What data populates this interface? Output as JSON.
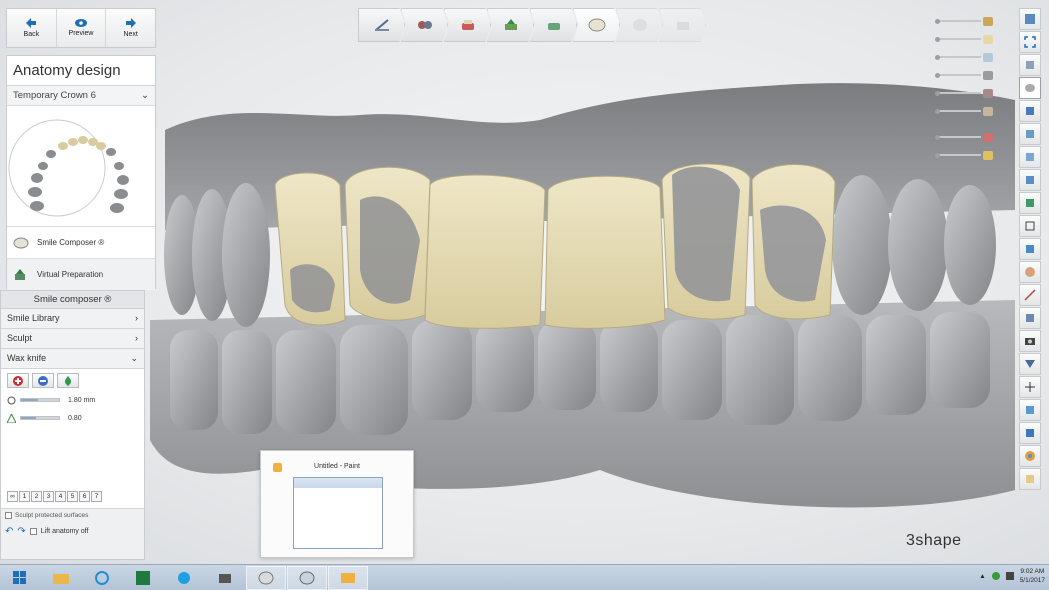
{
  "nav": {
    "back_label": "Back",
    "preview_label": "Preview",
    "next_label": "Next"
  },
  "workflow": {
    "steps": [
      "scan-step-icon",
      "preparation-step-icon",
      "crown-step-icon",
      "model-step-icon",
      "gingiva-step-icon",
      "anatomy-step-icon",
      "tooth-step-icon",
      "export-step-icon"
    ],
    "active_index": 5
  },
  "panel": {
    "title": "Anatomy design",
    "restoration": "Temporary Crown 6",
    "smile_composer_label": "Smile Composer ®",
    "virtual_preparation_label": "Virtual Preparation"
  },
  "smile_composer": {
    "header": "Smile composer ®",
    "sections": {
      "smile_library": "Smile Library",
      "sculpt": "Sculpt",
      "wax_knife": "Wax knife"
    },
    "wax_knife": {
      "radius_value": "1.80 mm",
      "strength_value": "0.80",
      "radius_fraction": 0.45,
      "strength_fraction": 0.4,
      "numbers": [
        "1",
        "2",
        "3",
        "4",
        "5",
        "6",
        "7"
      ]
    },
    "sculpt_protected_label": "Sculpt protected surfaces",
    "lift_anatomy_label": "Lift anatomy off"
  },
  "preview_window": {
    "title": "Untitled - Paint"
  },
  "brand": "3shape",
  "taskbar": {
    "apps": [
      "windows-start-icon",
      "file-explorer-icon",
      "internet-explorer-icon",
      "excel-icon",
      "skype-icon",
      "scanner-app-icon",
      "dental-system-icon",
      "model-builder-icon",
      "paint-icon"
    ],
    "clock_time": "9:02 AM",
    "clock_date": "5/1/2017"
  },
  "colors": {
    "crown": "#e6dcb4",
    "teeth": "#9c9ea1",
    "accent": "#1f6fb8"
  }
}
